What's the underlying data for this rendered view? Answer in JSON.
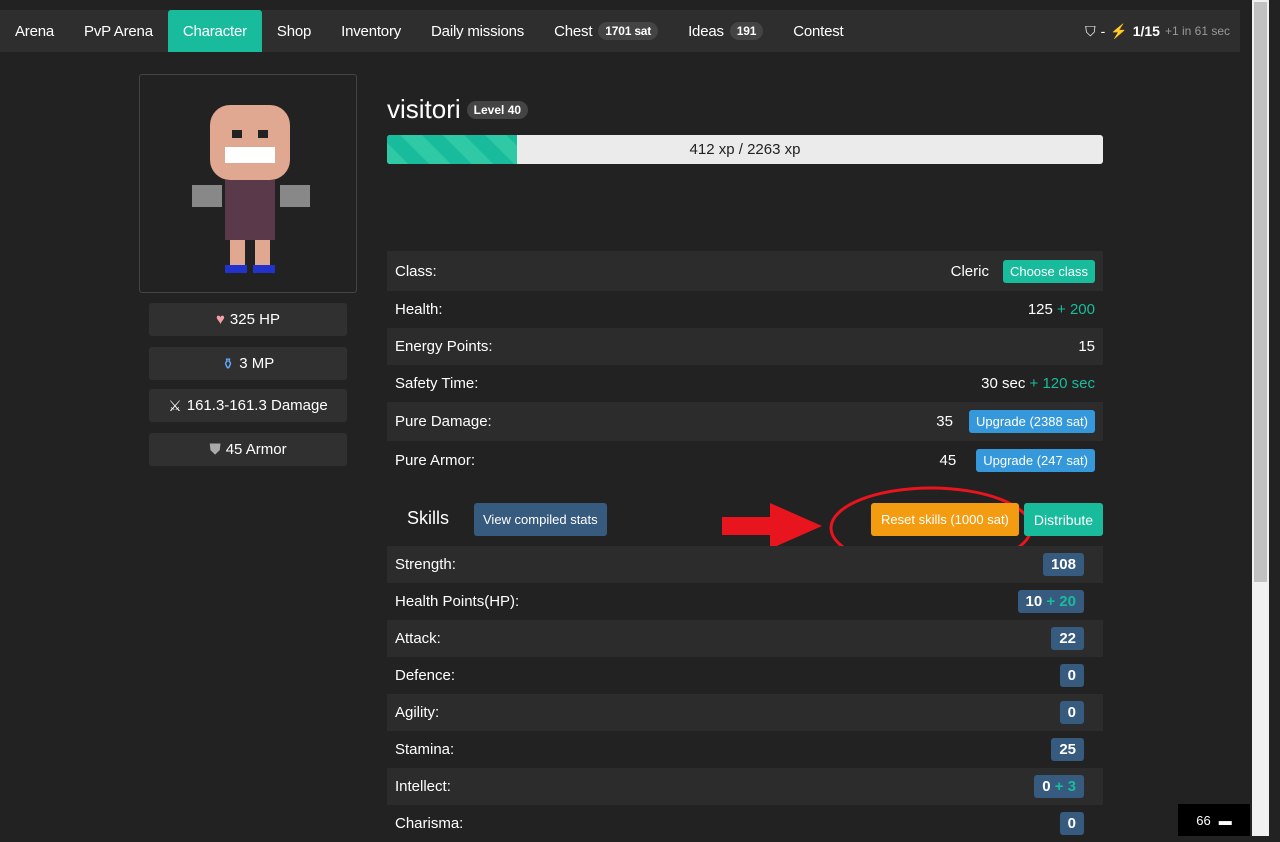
{
  "nav": {
    "items": [
      "Arena",
      "PvP Arena",
      "Character",
      "Shop",
      "Inventory",
      "Daily missions",
      "Chest",
      "Ideas",
      "Contest"
    ],
    "chest_badge": "1701 sat",
    "ideas_badge": "191",
    "shield_value": "-",
    "energy": "1/15",
    "energy_regen": "+1 in 61 sec"
  },
  "character": {
    "name": "visitori",
    "level": "Level 40",
    "xp_text": "412 xp / 2263 xp",
    "xp_progress": 0.182,
    "hp": "325 HP",
    "mp": "3 MP",
    "damage": "161.3-161.3 Damage",
    "armor": "45 Armor"
  },
  "info": {
    "class_label": "Class:",
    "class_value": "Cleric",
    "choose_class": "Choose class",
    "health_label": "Health:",
    "health_value": "125",
    "health_bonus": "+ 200",
    "energy_label": "Energy Points:",
    "energy_value": "15",
    "safety_label": "Safety Time:",
    "safety_value": "30 sec",
    "safety_bonus": "+ 120 sec",
    "damage_label": "Pure Damage:",
    "damage_value": "35",
    "damage_upgrade": "Upgrade (2388 sat)",
    "armor_label": "Pure Armor:",
    "armor_value": "45",
    "armor_upgrade": "Upgrade (247 sat)"
  },
  "skills": {
    "title": "Skills",
    "view_compiled": "View compiled stats",
    "reset": "Reset skills (1000 sat)",
    "distribute": "Distribute",
    "rows": [
      {
        "label": "Strength:",
        "value": "108",
        "bonus": ""
      },
      {
        "label": "Health Points(HP):",
        "value": "10",
        "bonus": "+ 20"
      },
      {
        "label": "Attack:",
        "value": "22",
        "bonus": ""
      },
      {
        "label": "Defence:",
        "value": "0",
        "bonus": ""
      },
      {
        "label": "Agility:",
        "value": "0",
        "bonus": ""
      },
      {
        "label": "Stamina:",
        "value": "25",
        "bonus": ""
      },
      {
        "label": "Intellect:",
        "value": "0",
        "bonus": "+ 3"
      },
      {
        "label": "Charisma:",
        "value": "0",
        "bonus": ""
      }
    ]
  },
  "chat": {
    "count": "66"
  }
}
